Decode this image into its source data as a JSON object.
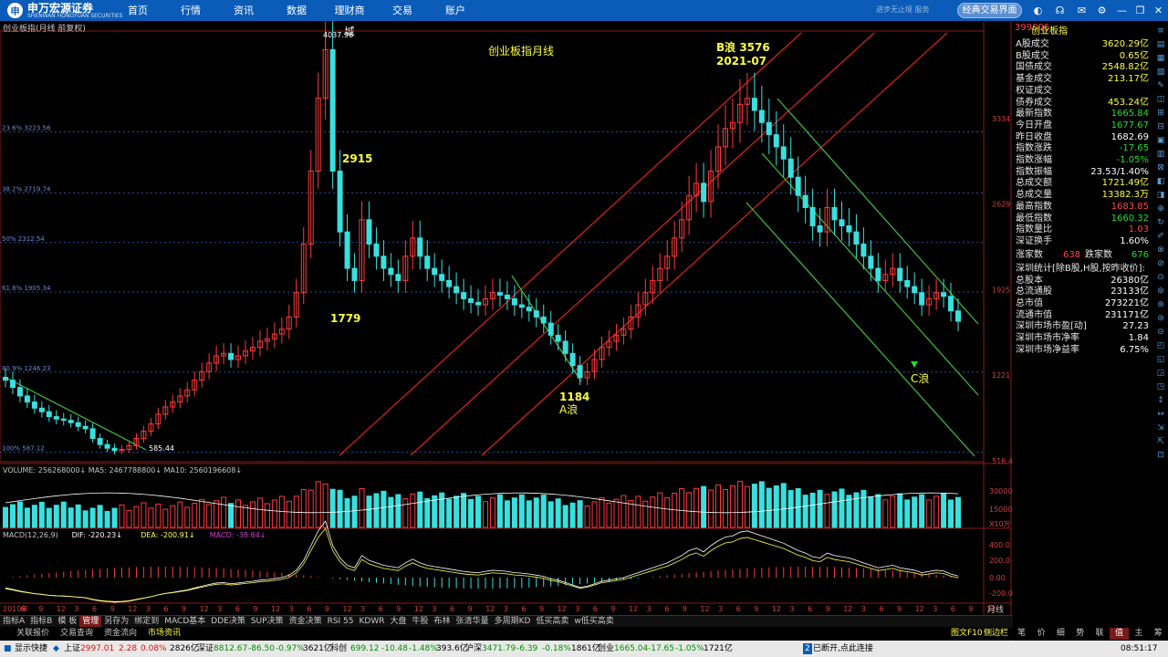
{
  "topbar": {
    "logo_text": "申万宏源证券",
    "logo_sub": "SHENWAN HONGYUAN SECURITIES",
    "nav": [
      "首页",
      "行情",
      "资讯",
      "数据",
      "理财商城",
      "交易",
      "账户"
    ],
    "slogan": "进步无止境 服务",
    "classic_button": "经典交易界面"
  },
  "chart": {
    "title": "创业板指(月线 前复权)",
    "annotation_title": "创业板指月线",
    "labels": {
      "high": "4037.96",
      "low": "585.44",
      "p2915": "2915",
      "p1779": "1779",
      "p1184": "1184",
      "a_wave": "A浪",
      "b_wave": "B浪 3576",
      "b_date": "2021-07",
      "c_wave": "C浪"
    },
    "fib_levels": [
      "23.6% 3223.56",
      "38.2% 2719.74",
      "50% 2312.54",
      "61.8% 1905.34",
      "80.9% 1246.23",
      "100% 587.12"
    ],
    "price_axis": [
      "3334",
      "2629",
      "1925",
      "1221",
      "516.4"
    ],
    "volume_label": "VOLUME: 256268000↓  MA5: 2467788800↓  MA10: 2560196608↓",
    "volume_axis": [
      "30000",
      "15000",
      "X10万"
    ],
    "macd_label_parts": [
      "MACD(12,26,9)",
      "DIF: -220.23↓",
      "DEA: -200.91↓",
      "MACD: -38.64↓"
    ],
    "macd_axis": [
      "400.0",
      "200.0",
      "0.00",
      "-200.0"
    ],
    "period_label": "月线",
    "x_labels": [
      "2010年",
      "6",
      "9",
      "12",
      "3",
      "6",
      "9",
      "12",
      "3",
      "6",
      "9",
      "12",
      "3",
      "6",
      "9",
      "12",
      "3",
      "6",
      "9",
      "12",
      "3",
      "6",
      "9",
      "12",
      "3",
      "6",
      "9",
      "12",
      "3",
      "6",
      "9",
      "12",
      "3",
      "6",
      "9",
      "12",
      "3",
      "6",
      "9",
      "12",
      "3",
      "6",
      "9",
      "12",
      "3",
      "6",
      "9",
      "12",
      "3",
      "6",
      "9",
      "12",
      "3",
      "6",
      "9",
      "12"
    ]
  },
  "chart_data": {
    "type": "candlestick",
    "title": "创业板指月线",
    "series_note": "monthly index",
    "key_points": [
      {
        "label": "low",
        "value": 585.44
      },
      {
        "label": "high",
        "value": 4037.96
      },
      {
        "label": "2915",
        "value": 2915
      },
      {
        "label": "1779",
        "value": 1779
      },
      {
        "label": "A浪",
        "value": 1184
      },
      {
        "label": "B浪",
        "value": 3576,
        "date": "2021-07"
      }
    ],
    "fib": [
      {
        "pct": "23.6%",
        "value": 3223.56
      },
      {
        "pct": "38.2%",
        "value": 2719.74
      },
      {
        "pct": "50%",
        "value": 2312.54
      },
      {
        "pct": "61.8%",
        "value": 1905.34
      },
      {
        "pct": "80.9%",
        "value": 1246.23
      },
      {
        "pct": "100%",
        "value": 587.12
      }
    ],
    "ylim": [
      516.4,
      4037.96
    ],
    "closes": [
      1180,
      1120,
      1050,
      1000,
      950,
      920,
      880,
      860,
      850,
      830,
      800,
      780,
      700,
      650,
      620,
      600,
      610,
      640,
      700,
      760,
      820,
      900,
      960,
      1000,
      1050,
      1100,
      1180,
      1250,
      1320,
      1380,
      1400,
      1350,
      1380,
      1420,
      1450,
      1500,
      1520,
      1560,
      1600,
      1700,
      1900,
      2300,
      2900,
      3500,
      3900,
      2900,
      2400,
      2100,
      2000,
      2500,
      2300,
      2200,
      2100,
      2050,
      2000,
      2200,
      2350,
      2200,
      2100,
      2050,
      2000,
      1950,
      1900,
      1850,
      1820,
      1800,
      1850,
      1900,
      1880,
      1850,
      1800,
      1780,
      1750,
      1700,
      1650,
      1550,
      1500,
      1400,
      1300,
      1200,
      1250,
      1350,
      1450,
      1500,
      1550,
      1600,
      1700,
      1800,
      1900,
      2000,
      2100,
      2200,
      2350,
      2500,
      2700,
      2800,
      2650,
      2900,
      3100,
      3250,
      3300,
      3450,
      3500,
      3400,
      3300,
      3200,
      3100,
      3000,
      2850,
      2700,
      2600,
      2450,
      2400,
      2600,
      2500,
      2450,
      2400,
      2300,
      2200,
      2100,
      2000,
      2050,
      2100,
      2000,
      1950,
      1900,
      1800,
      1850,
      1900,
      1870,
      1750,
      1665
    ]
  },
  "quote_panel": {
    "code": "399006",
    "name": "创业板指",
    "rows": [
      {
        "label": "A股成交",
        "value": "3620.29亿",
        "color": "yellow"
      },
      {
        "label": "B股成交",
        "value": "0.65亿",
        "color": "yellow"
      },
      {
        "label": "国债成交",
        "value": "2548.82亿",
        "color": "yellow"
      },
      {
        "label": "基金成交",
        "value": "213.17亿",
        "color": "yellow"
      },
      {
        "label": "权证成交",
        "value": "",
        "color": "yellow"
      },
      {
        "label": "债券成交",
        "value": "453.24亿",
        "color": "yellow"
      },
      {
        "label": "最新指数",
        "value": "1665.84",
        "color": "grn"
      },
      {
        "label": "今日开盘",
        "value": "1677.67",
        "color": "grn"
      },
      {
        "label": "昨日收盘",
        "value": "1682.69",
        "color": "wht"
      },
      {
        "label": "指数涨跌",
        "value": "-17.65",
        "color": "grn"
      },
      {
        "label": "指数涨幅",
        "value": "-1.05%",
        "color": "grn"
      },
      {
        "label": "指数振幅",
        "value": "23.53/1.40%",
        "color": "wht"
      },
      {
        "label": "总成交额",
        "value": "1721.49亿",
        "color": "yellow"
      },
      {
        "label": "总成交量",
        "value": "13382.3万",
        "color": "yellow"
      },
      {
        "label": "最高指数",
        "value": "1683.85",
        "color": "red"
      },
      {
        "label": "最低指数",
        "value": "1660.32",
        "color": "grn"
      },
      {
        "label": "指数量比",
        "value": "1.03",
        "color": "red"
      },
      {
        "label": "深证换手",
        "value": "1.60%",
        "color": "wht"
      }
    ],
    "up_label": "涨家数",
    "up_value": "638",
    "down_label": "跌家数",
    "down_value": "676",
    "stat_title": "深圳统计[除B股,H股,按昨收价]:",
    "stats": [
      {
        "label": "总股本",
        "value": "26380亿"
      },
      {
        "label": "总流通股",
        "value": "23133亿"
      },
      {
        "label": "总市值",
        "value": "273221亿"
      },
      {
        "label": "流通市值",
        "value": "231171亿"
      },
      {
        "label": "深圳市场市盈[动]",
        "value": "27.23"
      },
      {
        "label": "深圳市场市净率",
        "value": "1.84"
      },
      {
        "label": "深圳市场净益率",
        "value": "6.75%"
      }
    ]
  },
  "indicator_tabs": [
    "指标A",
    "指标B",
    "模 板",
    "管理",
    "另存为",
    "绑定到",
    "MACD基本",
    "DDE决策",
    "SUP决策",
    "资金决策",
    "RSI 55",
    "KDWR",
    "大盘",
    "牛股",
    "布林",
    "张清华量",
    "多周期KD",
    "低买高卖",
    "w低买高卖"
  ],
  "row2_tabs": [
    "关联报价",
    "交易查询",
    "资金流向",
    "市场资讯"
  ],
  "row2_right": [
    "图文F10",
    "侧边栏"
  ],
  "right_tabs": [
    "笔",
    "价",
    "细",
    "势",
    "联",
    "值",
    "主",
    "筹"
  ],
  "bottom": {
    "show_fast": "显示快捷",
    "sh_name": "上证",
    "sh_price": "2997.01",
    "sh_chg": "2.28",
    "sh_pct": "0.08%",
    "sh_amt": "2826亿",
    "sz_name": "深证",
    "sz_price": "8812.67",
    "sz_chg": "-86.50",
    "sz_pct": "-0.97%",
    "sz_amt": "3621亿",
    "kc_name": "科创",
    "kc_price": "699.12",
    "kc_chg": "-10.48",
    "kc_pct": "-1.48%",
    "kc_amt": "393.6亿",
    "hs_name": "沪深",
    "hs_price": "3471.79",
    "hs_chg": "-6.39",
    "hs_pct": "-0.18%",
    "hs_amt": "1861亿",
    "cy_name": "创业",
    "cy_price": "1665.04",
    "cy_chg": "-17.65",
    "cy_pct": "-1.05%",
    "cy_amt": "1721亿",
    "msg_num": "2",
    "msg": "已断开,点此连接",
    "time": "08:51:17"
  }
}
